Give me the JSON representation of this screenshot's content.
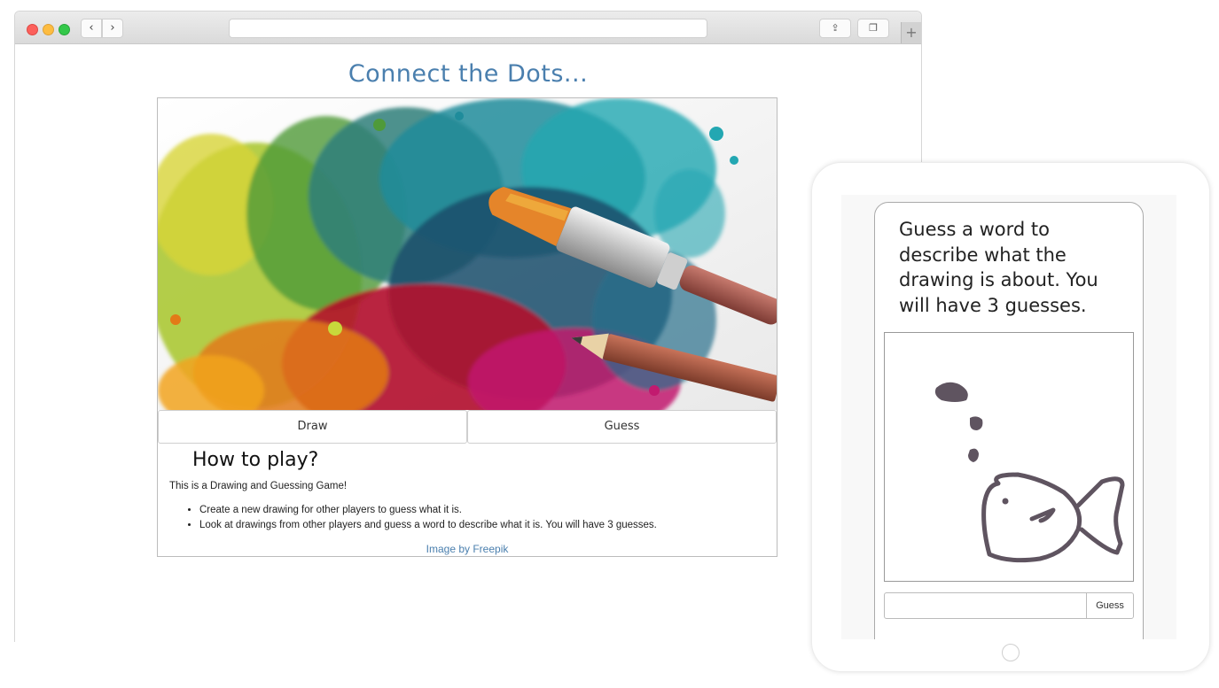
{
  "browser": {
    "back_icon": "‹",
    "forward_icon": "›",
    "share_icon": "⇪",
    "tabs_icon": "❐",
    "newtab_icon": "+"
  },
  "page": {
    "title": "Connect the Dots...",
    "buttons": {
      "draw": "Draw",
      "guess": "Guess"
    },
    "how_to_heading": "How to play?",
    "intro": "This is a Drawing and Guessing Game!",
    "rules": [
      "Create a new drawing for other players to guess what it is.",
      "Look at drawings from other players and guess a word to describe what it is. You will have 3 guesses."
    ],
    "credit_prefix": "Image by ",
    "credit_link": "Freepik"
  },
  "tablet": {
    "prompt": "Guess a word to describe what the drawing is about. You will have 3 guesses.",
    "input_value": "",
    "guess_button": "Guess"
  },
  "colors": {
    "title_blue": "#4a7fae",
    "sketch": "#5f5460"
  }
}
